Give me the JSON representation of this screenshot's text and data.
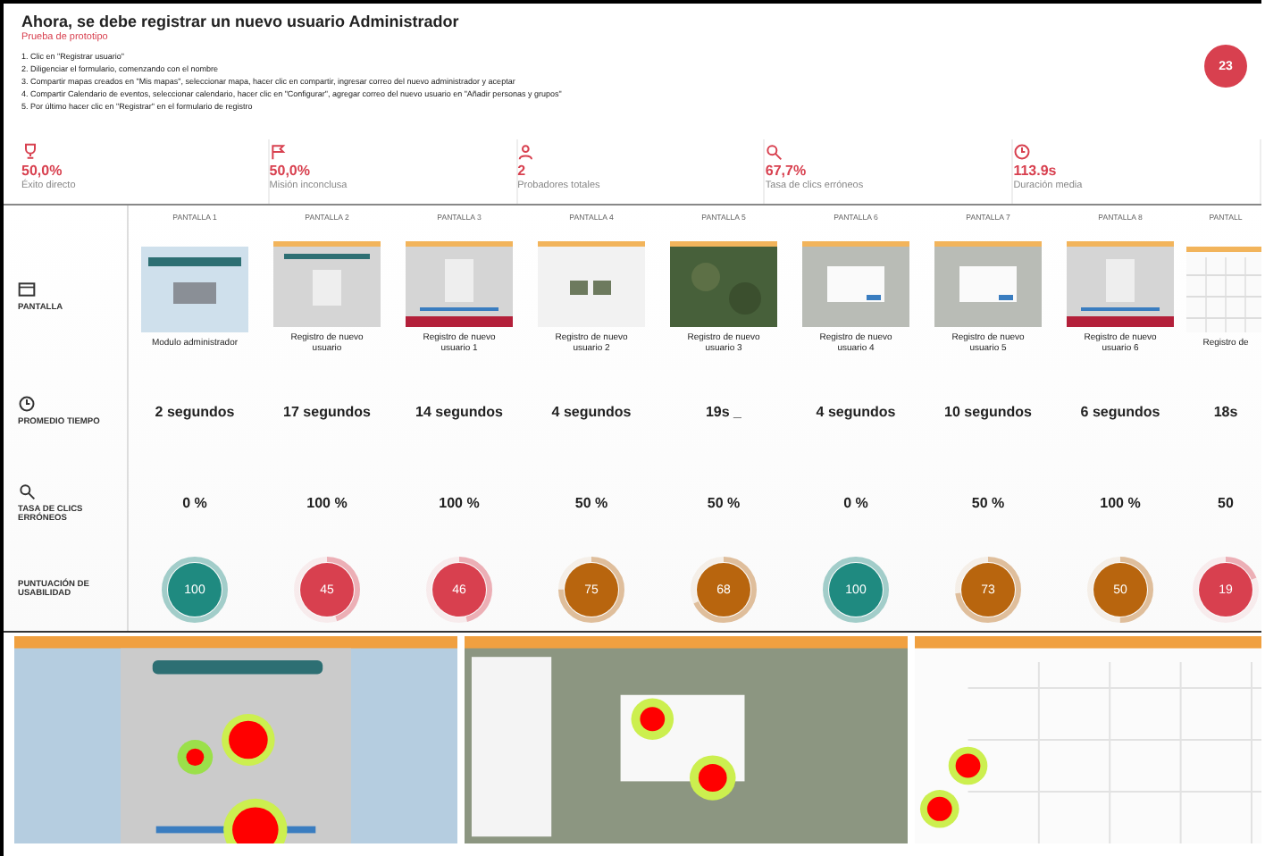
{
  "header": {
    "title": "Ahora, se debe registrar un nuevo usuario Administrador",
    "subtitle": "Prueba de prototipo",
    "steps": [
      "1. Clic en \"Registrar usuario\"",
      "2. Diligenciar el formulario, comenzando con el nombre",
      "3. Compartir mapas creados en \"Mis mapas\", seleccionar mapa, hacer clic en compartir, ingresar correo del nuevo administrador y aceptar",
      "4. Compartir Calendario de eventos, seleccionar calendario, hacer clic en \"Configurar\", agregar correo del nuevo usuario en \"Añadir personas y grupos\"",
      "5. Por último hacer clic en \"Registrar\" en el formulario de registro"
    ],
    "badge": "23"
  },
  "metrics": [
    {
      "kind": "trophy",
      "value": "50,0%",
      "label": "Éxito directo"
    },
    {
      "kind": "flag",
      "value": "50,0%",
      "label": "Misión inconclusa"
    },
    {
      "kind": "users",
      "value": "2",
      "label": "Probadores totales"
    },
    {
      "kind": "click",
      "value": "67,7%",
      "label": "Tasa de clics erróneos"
    },
    {
      "kind": "clock",
      "value": "113.9s",
      "label": "Duración media"
    }
  ],
  "row_labels": [
    {
      "kind": "screen",
      "label": "PANTALLA"
    },
    {
      "kind": "clock",
      "label": "PROMEDIO TIEMPO"
    },
    {
      "kind": "click",
      "label": "TASA DE CLICS ERRÓNEOS"
    },
    {
      "kind": "none",
      "label": "PUNTUACIÓN DE USABILIDAD"
    }
  ],
  "screens": [
    {
      "header": "PANTALLA 1",
      "kind": "blue",
      "caption": "Modulo administrador",
      "time": "2 segundos",
      "error_rate": "0 %",
      "score": "100",
      "level": 1.0,
      "color": "#1f8a80"
    },
    {
      "header": "PANTALLA 2",
      "kind": "form",
      "caption": "Registro de nuevo usuario",
      "time": "17 segundos",
      "error_rate": "100 %",
      "score": "45",
      "level": 0.45,
      "color": "#d8404f"
    },
    {
      "header": "PANTALLA 3",
      "kind": "formred",
      "caption": "Registro de nuevo usuario 1",
      "time": "14 segundos",
      "error_rate": "100 %",
      "score": "46",
      "level": 0.46,
      "color": "#d8404f"
    },
    {
      "header": "PANTALLA 4",
      "kind": "page",
      "caption": "Registro de nuevo usuario 2",
      "time": "4 segundos",
      "error_rate": "50 %",
      "score": "75",
      "level": 0.75,
      "color": "#b8650e"
    },
    {
      "header": "PANTALLA 5",
      "kind": "map",
      "caption": "Registro de nuevo usuario 3",
      "time": "19s _",
      "error_rate": "50 %",
      "score": "68",
      "level": 0.68,
      "color": "#b8650e"
    },
    {
      "header": "PANTALLA 6",
      "kind": "dialog",
      "caption": "Registro de nuevo usuario 4",
      "time": "4 segundos",
      "error_rate": "0 %",
      "score": "100",
      "level": 1.0,
      "color": "#1f8a80"
    },
    {
      "header": "PANTALLA 7",
      "kind": "dialog",
      "caption": "Registro de nuevo usuario 5",
      "time": "10 segundos",
      "error_rate": "50 %",
      "score": "73",
      "level": 0.73,
      "color": "#b8650e"
    },
    {
      "header": "PANTALLA 8",
      "kind": "formred",
      "caption": "Registro de nuevo usuario 6",
      "time": "6 segundos",
      "error_rate": "100 %",
      "score": "50",
      "level": 0.5,
      "color": "#b8650e"
    },
    {
      "header": "PANTALL",
      "kind": "calendar",
      "caption": "Registro de",
      "time": "18s",
      "error_rate": "50",
      "score": "19",
      "level": 0.19,
      "color": "#d8404f"
    }
  ],
  "heatmaps": [
    {
      "kind": "site"
    },
    {
      "kind": "map"
    },
    {
      "kind": "calendar"
    }
  ]
}
